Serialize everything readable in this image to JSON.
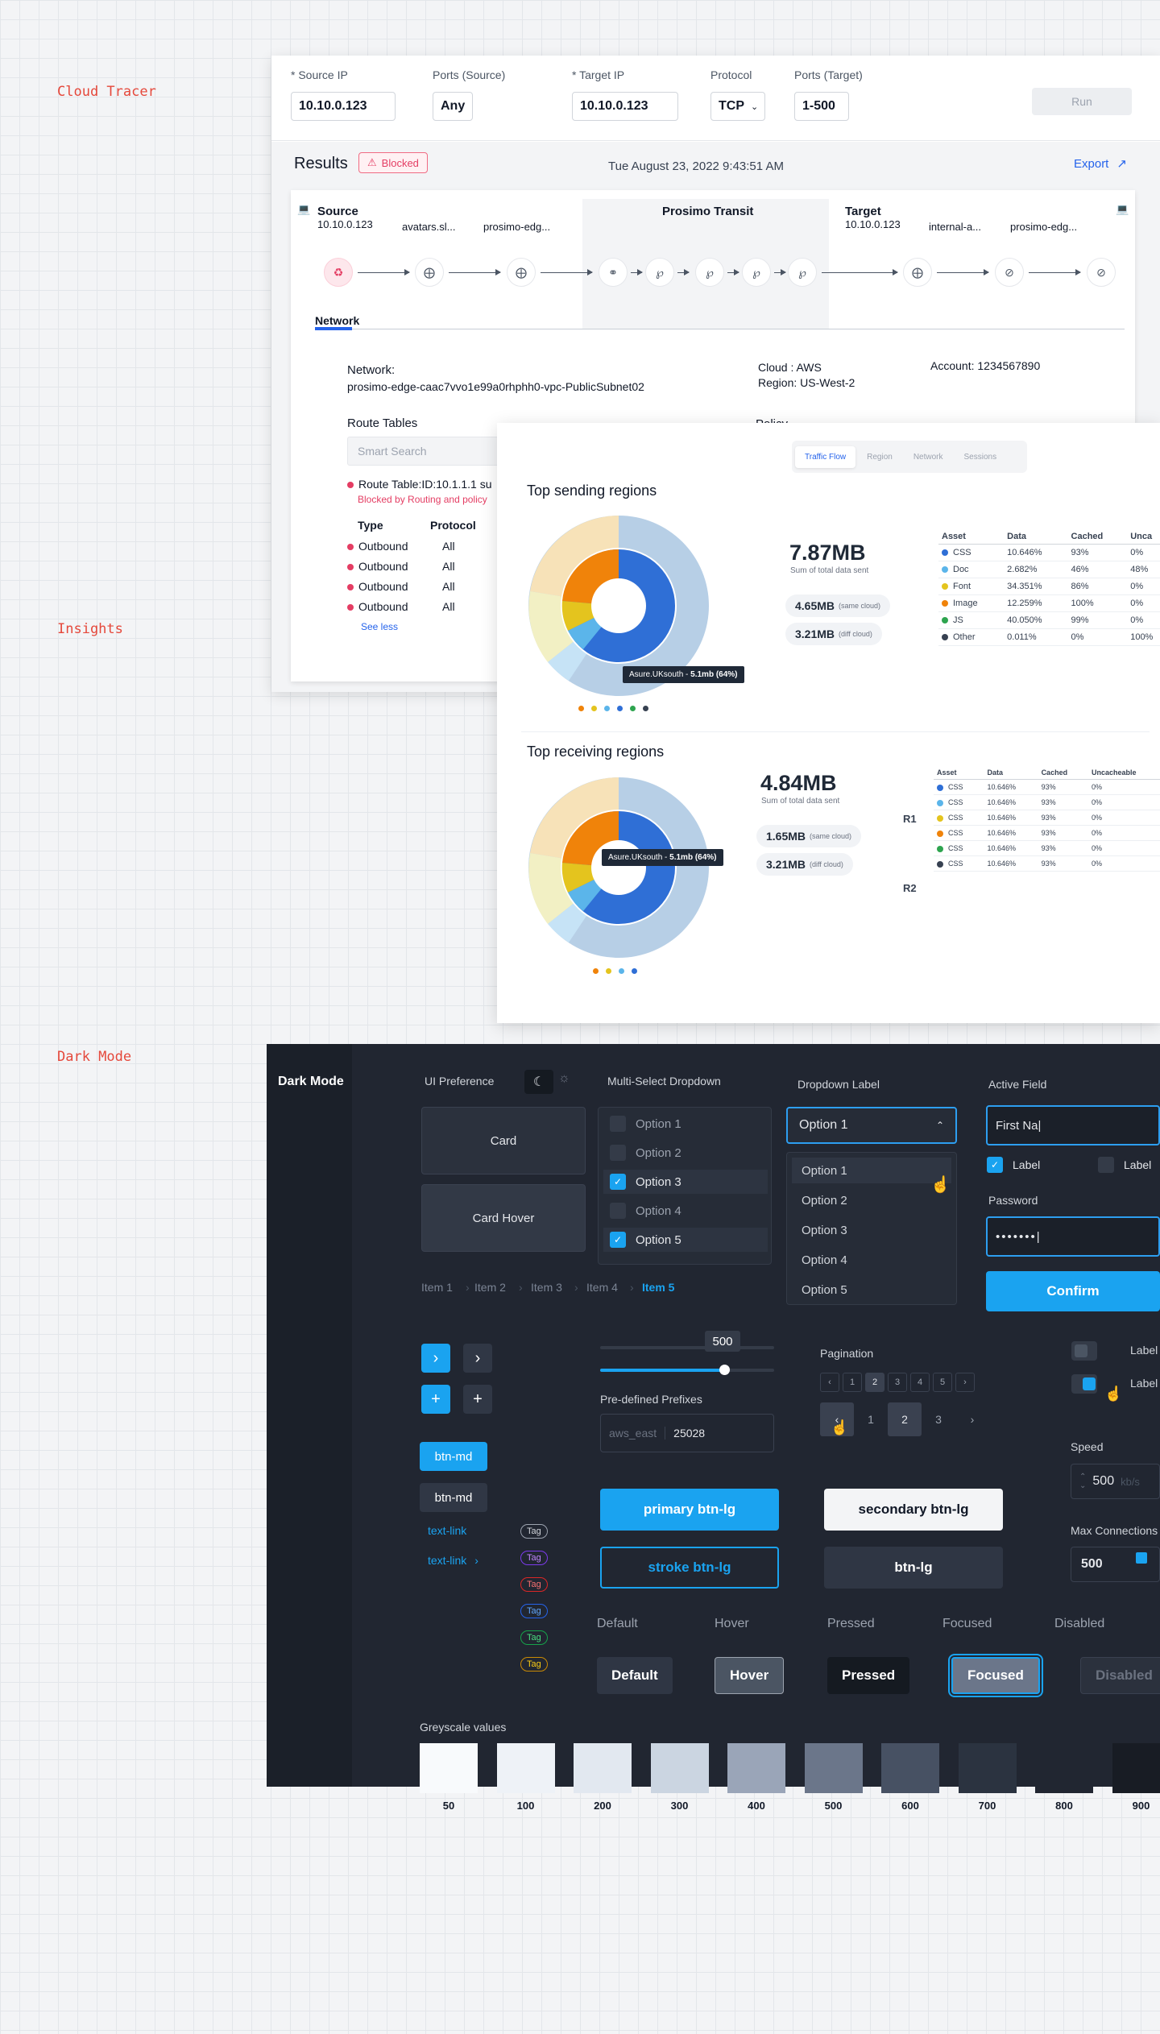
{
  "sections": {
    "cloud_tracer": "Cloud Tracer",
    "insights": "Insights",
    "dark_mode": "Dark Mode"
  },
  "tracer": {
    "fields": {
      "source_ip_label": "* Source IP",
      "source_ip": "10.10.0.123",
      "ports_source_label": "Ports (Source)",
      "ports_source": "Any",
      "target_ip_label": "* Target IP",
      "target_ip": "10.10.0.123",
      "protocol_label": "Protocol",
      "protocol": "TCP",
      "ports_target_label": "Ports (Target)",
      "ports_target": "1-500",
      "run": "Run"
    },
    "results": "Results",
    "blocked": "Blocked",
    "datetime": "Tue August 23, 2022 9:43:51 AM",
    "export": "Export",
    "path": {
      "source_label": "Source",
      "source_ip": "10.10.0.123",
      "hop1": "avatars.sl...",
      "hop2": "prosimo-edg...",
      "transit": "Prosimo Transit",
      "target_label": "Target",
      "target_ip": "10.10.0.123",
      "hop3": "internal-a...",
      "hop4": "prosimo-edg..."
    },
    "network_tab": "Network",
    "network_label": "Network:",
    "network_value": "prosimo-edge-caac7vvo1e99a0rhphh0-vpc-PublicSubnet02",
    "cloud": "Cloud : AWS",
    "region": "Region: US-West-2",
    "account": "Account: 1234567890",
    "route_tables": "Route Tables",
    "policy": "Policy",
    "smart_search": "Smart Search",
    "route_table_id": "Route Table:ID:10.1.1.1 su",
    "blocked_reason": "Blocked by Routing and policy",
    "type_col": "Type",
    "protocol_col": "Protocol",
    "rows": [
      {
        "type": "Outbound",
        "protocol": "All"
      },
      {
        "type": "Outbound",
        "protocol": "All"
      },
      {
        "type": "Outbound",
        "protocol": "All"
      },
      {
        "type": "Outbound",
        "protocol": "All"
      }
    ],
    "see_less": "See less"
  },
  "insights": {
    "tabs": [
      "Traffic Flow",
      "Region",
      "Network",
      "Sessions"
    ],
    "sending": {
      "title": "Top sending regions",
      "total": "7.87MB",
      "total_sub": "Sum of total data sent",
      "same": "4.65MB",
      "same_sub": "(same cloud)",
      "diff": "3.21MB",
      "diff_sub": "(diff cloud)",
      "tooltip_prefix": "Asure.UKsouth - ",
      "tooltip_value": "5.1mb (64%)",
      "headers": [
        "Asset",
        "Data",
        "Cached",
        "Unca"
      ],
      "rows": [
        {
          "asset": "CSS",
          "data": "10.646%",
          "cached": "93%",
          "unc": "0%",
          "color": "#2f6fd6"
        },
        {
          "asset": "Doc",
          "data": "2.682%",
          "cached": "46%",
          "unc": "48%",
          "color": "#5bb5ea"
        },
        {
          "asset": "Font",
          "data": "34.351%",
          "cached": "86%",
          "unc": "0%",
          "color": "#e4c41e"
        },
        {
          "asset": "Image",
          "data": "12.259%",
          "cached": "100%",
          "unc": "0%",
          "color": "#f0830a"
        },
        {
          "asset": "JS",
          "data": "40.050%",
          "cached": "99%",
          "unc": "0%",
          "color": "#2ea44f"
        },
        {
          "asset": "Other",
          "data": "0.011%",
          "cached": "0%",
          "unc": "100%",
          "color": "#374151"
        }
      ]
    },
    "receiving": {
      "title": "Top receiving regions",
      "total": "4.84MB",
      "total_sub": "Sum of total data sent",
      "same": "1.65MB",
      "same_sub": "(same cloud)",
      "diff": "3.21MB",
      "diff_sub": "(diff cloud)",
      "tooltip_prefix": "Asure.UKsouth - ",
      "tooltip_value": "5.1mb (64%)",
      "r1": "R1",
      "r2": "R2",
      "headers": [
        "Asset",
        "Data",
        "Cached",
        "Uncacheable"
      ],
      "rows": [
        {
          "asset": "CSS",
          "data": "10.646%",
          "cached": "93%",
          "unc": "0%",
          "color": "#2f6fd6"
        },
        {
          "asset": "CSS",
          "data": "10.646%",
          "cached": "93%",
          "unc": "0%",
          "color": "#5bb5ea"
        },
        {
          "asset": "CSS",
          "data": "10.646%",
          "cached": "93%",
          "unc": "0%",
          "color": "#e4c41e"
        },
        {
          "asset": "CSS",
          "data": "10.646%",
          "cached": "93%",
          "unc": "0%",
          "color": "#f0830a"
        },
        {
          "asset": "CSS",
          "data": "10.646%",
          "cached": "93%",
          "unc": "0%",
          "color": "#2ea44f"
        },
        {
          "asset": "CSS",
          "data": "10.646%",
          "cached": "93%",
          "unc": "0%",
          "color": "#374151"
        }
      ]
    }
  },
  "dark": {
    "title": "Dark Mode",
    "ui_pref": "UI Preference",
    "card": "Card",
    "card_hover": "Card Hover",
    "multi_select": "Multi-Select Dropdown",
    "ms_options": [
      "Option 1",
      "Option 2",
      "Option 3",
      "Option 4",
      "Option 5"
    ],
    "ms_checked": [
      false,
      false,
      true,
      false,
      true
    ],
    "dropdown_label": "Dropdown Label",
    "dropdown_value": "Option 1",
    "dd_options": [
      "Option 1",
      "Option 2",
      "Option 3",
      "Option 4",
      "Option 5"
    ],
    "active_field": "Active Field",
    "active_value": "First Na|",
    "label": "Label",
    "password": "Password",
    "password_value": "•••••••|",
    "confirm": "Confirm",
    "breadcrumb": [
      "Item 1",
      "Item 2",
      "Item 3",
      "Item 4",
      "Item 5"
    ],
    "slider_value": "500",
    "prefixes": "Pre-defined Prefixes",
    "prefix": "aws_east",
    "prefix_value": "25028",
    "pagination": "Pagination",
    "pages_small": [
      "1",
      "2",
      "3",
      "4",
      "5"
    ],
    "pages_large": [
      "1",
      "2",
      "3"
    ],
    "speed": "Speed",
    "speed_value": "500",
    "speed_unit": "kb/s",
    "max_conn": "Max Connections",
    "max_value": "500",
    "btn_md": "btn-md",
    "text_link": "text-link",
    "tag": "Tag",
    "primary": "primary btn-lg",
    "secondary": "secondary btn-lg",
    "stroke": "stroke btn-lg",
    "btn_lg": "btn-lg",
    "states": [
      "Default",
      "Hover",
      "Pressed",
      "Focused",
      "Disabled"
    ],
    "greyscale_title": "Greyscale values",
    "greyscale": [
      {
        "label": "50",
        "color": "#f8fafc"
      },
      {
        "label": "100",
        "color": "#eef2f7"
      },
      {
        "label": "200",
        "color": "#e2e8f0"
      },
      {
        "label": "300",
        "color": "#cbd5e1"
      },
      {
        "label": "400",
        "color": "#9aa5b8"
      },
      {
        "label": "500",
        "color": "#6b768a"
      },
      {
        "label": "600",
        "color": "#475163"
      },
      {
        "label": "700",
        "color": "#2b3340"
      },
      {
        "label": "800",
        "color": "#212631"
      },
      {
        "label": "900",
        "color": "#181c24"
      }
    ]
  }
}
